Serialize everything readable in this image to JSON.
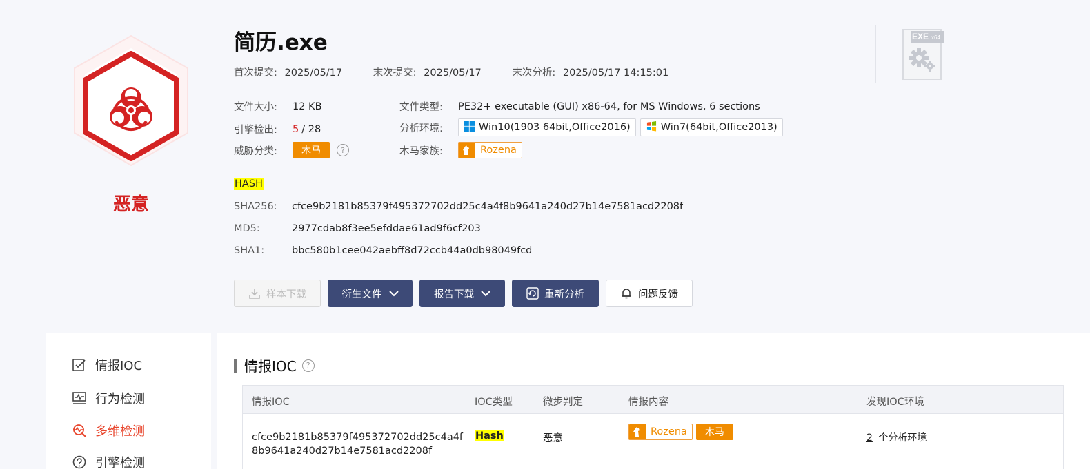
{
  "verdict": {
    "label": "恶意"
  },
  "file": {
    "name": "简历.exe",
    "first_submit_label": "首次提交:",
    "first_submit": "2025/05/17",
    "last_submit_label": "末次提交:",
    "last_submit": "2025/05/17",
    "last_analysis_label": "末次分析:",
    "last_analysis": "2025/05/17 14:15:01",
    "size_label": "文件大小:",
    "size": "12 KB",
    "type_label": "文件类型:",
    "type": "PE32+ executable (GUI) x86-64, for MS Windows, 6 sections",
    "engine_label": "引擎检出:",
    "engine_detected": "5",
    "engine_total": "/ 28",
    "env_label": "分析环境:",
    "envs": [
      "Win10(1903 64bit,Office2016)",
      "Win7(64bit,Office2013)"
    ],
    "threat_label": "威胁分类:",
    "threat": "木马",
    "family_label": "木马家族:",
    "family": "Rozena",
    "filetype_badge": "EXE",
    "filetype_sub": "x64"
  },
  "hash": {
    "title": "HASH",
    "sha256_label": "SHA256:",
    "sha256": "cfce9b2181b85379f495372702dd25c4a4f8b9641a240d27b14e7581acd2208f",
    "md5_label": "MD5:",
    "md5": "2977cdab8f3ee5efddae61ad9f6cf203",
    "sha1_label": "SHA1:",
    "sha1": "bbc580b1cee042aebff8d72ccb44a0db98049fcd"
  },
  "actions": {
    "download_sample": "样本下载",
    "derived_files": "衍生文件",
    "report_download": "报告下载",
    "reanalyze": "重新分析",
    "feedback": "问题反馈"
  },
  "sidebar": {
    "items": [
      "情报IOC",
      "行为检测",
      "多维检测",
      "引擎检测"
    ]
  },
  "ioc_section": {
    "title": "情报IOC",
    "columns": [
      "情报IOC",
      "IOC类型",
      "微步判定",
      "情报内容",
      "发现IOC环境"
    ],
    "rows": [
      {
        "ioc_line1": "cfce9b2181b85379f495372702dd25c4a4f",
        "ioc_line2": "8b9641a240d27b14e7581acd2208f",
        "type": "Hash",
        "verdict": "恶意",
        "family": "Rozena",
        "threat": "木马",
        "env_count": "2",
        "env_suffix": "个分析环境"
      }
    ]
  },
  "colors": {
    "malicious": "#d42323",
    "accent": "#e8452c",
    "button_dark": "#3d4a77",
    "tag_orange": "#f08c00",
    "highlight": "#ffff00"
  }
}
